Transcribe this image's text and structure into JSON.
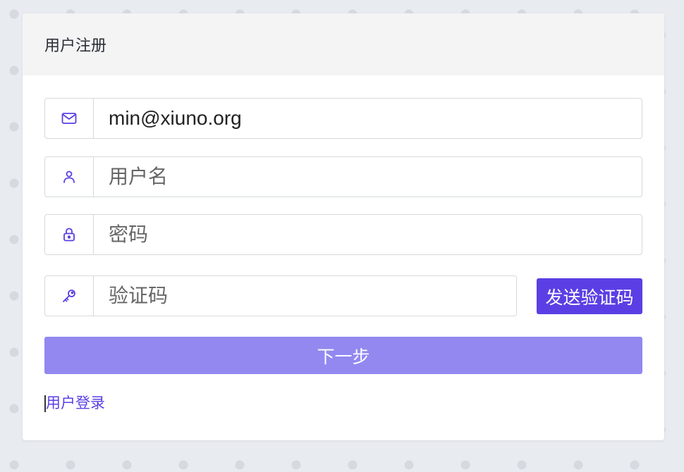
{
  "form": {
    "title": "用户注册",
    "email": {
      "value": "min@xiuno.org",
      "icon": "envelope-icon"
    },
    "username": {
      "placeholder": "用户名",
      "icon": "user-icon"
    },
    "password": {
      "placeholder": "密码",
      "icon": "lock-icon"
    },
    "code": {
      "placeholder": "验证码",
      "icon": "key-icon"
    },
    "send_code_label": "发送验证码",
    "next_label": "下一步",
    "login_link": "用户登录"
  },
  "colors": {
    "accent": "#5b3fe4",
    "next_button": "#9288f0",
    "header_bg": "#f4f4f5"
  }
}
